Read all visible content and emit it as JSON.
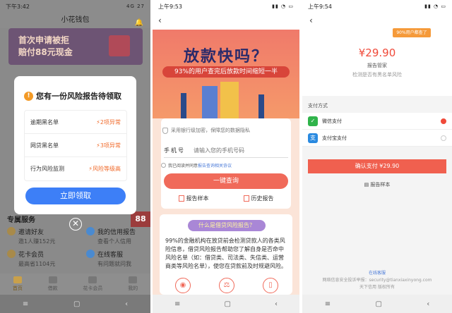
{
  "panel1": {
    "status_time": "下午3:42",
    "status_right": "4G 27",
    "title": "小花钱包",
    "banner": {
      "line1": "首次申请被拒",
      "line2": "赔付88元现金"
    },
    "modal": {
      "title": "您有一份风险报告待领取",
      "rows": [
        {
          "label": "逾期黑名单",
          "status": "2项异常"
        },
        {
          "label": "网贷黑名单",
          "status": "3项异常"
        },
        {
          "label": "行为风险监测",
          "status": "风险等级高"
        }
      ],
      "cta": "立即领取"
    },
    "services_title": "专属服务",
    "badge": "88",
    "services": [
      {
        "name": "邀请好友",
        "sub": "邀1人赚152元"
      },
      {
        "name": "我的信用报告",
        "sub": "查看个人信用"
      },
      {
        "name": "花卡会员",
        "sub": "最高省1104元"
      },
      {
        "name": "在线客服",
        "sub": "有问题就问我"
      }
    ],
    "tabs": [
      "首页",
      "借款",
      "花卡会员",
      "我的"
    ]
  },
  "panel2": {
    "status_time": "上午9:53",
    "hero_title": "放款快吗？",
    "hero_sub": "93%的用户查完后放款时间缩短一半",
    "secure_text": "采用银行级加密，保障您的数据隐私",
    "phone_label": "手机号",
    "phone_placeholder": "请输入您的手机号码",
    "agree_text": "我已阅读并同意",
    "agree_link": "报告查询相关协议",
    "query_button": "一键查询",
    "link_sample": "报告样本",
    "link_history": "历史报告",
    "section_pill": "什么是借贷风险报告？",
    "section_body": "99%的金融机构在放贷前会检测贷款人的各类风险信息，借贷风险报告帮助您了解自身是否命中风险名单（如：借贷类、司法类、失信类、运营商类等风险名单），使您在贷款前及时规避风险。"
  },
  "panel3": {
    "status_time": "上午9:54",
    "tag": "90%用户都查了",
    "price": "¥29.90",
    "product_name": "报告管家",
    "product_desc": "检测是否有黑名单风险",
    "pay_label": "支付方式",
    "options": [
      {
        "name": "微信支付",
        "color": "#2fb34a",
        "icon": "✓"
      },
      {
        "name": "支付宝支付",
        "color": "#2a8ae0",
        "icon": "支"
      }
    ],
    "confirm": "确认支付 ¥29.90",
    "sample": "报告样本",
    "footer_link": "在线客服",
    "footer_contact": "网络信息安全投诉举报：security@tianxiaxinyong.com",
    "footer_brand": "天下信用  版权所有"
  }
}
